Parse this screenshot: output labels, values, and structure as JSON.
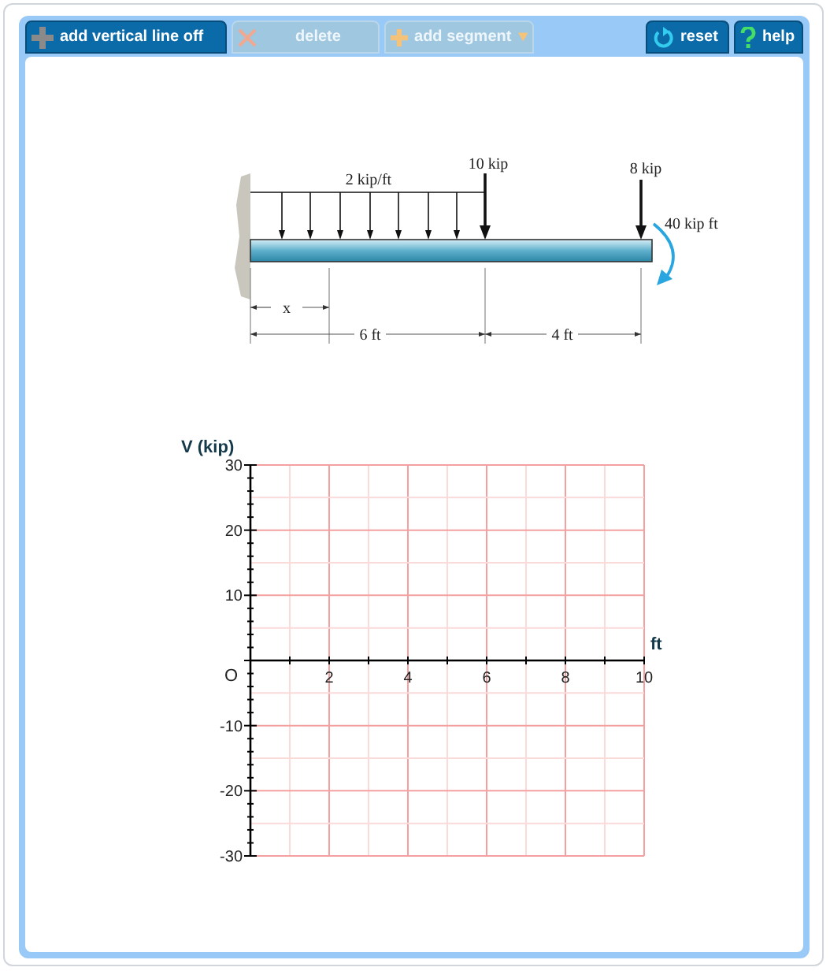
{
  "toolbar": [
    {
      "kind": "toggle",
      "label": "add vertical line off",
      "disabled": false
    },
    {
      "kind": "delete",
      "label": "delete",
      "disabled": true
    },
    {
      "kind": "dropdown",
      "label": "add segment",
      "disabled": true
    },
    {
      "kind": "reset",
      "label": "reset",
      "disabled": false
    },
    {
      "kind": "help",
      "label": "help",
      "disabled": false
    }
  ],
  "beam_diagram": {
    "distributed_load": "2 kip/ft",
    "point_load_1": "10 kip",
    "point_load_2": "8 kip",
    "moment": "40 kip ft",
    "position_label": "x",
    "span_1": "6 ft",
    "span_2": "4 ft"
  },
  "shear_plot": {
    "origin_label": "O",
    "chart_data": {
      "type": "line",
      "xlabel": "ft",
      "ylabel": "V (kip)",
      "xlim": [
        0,
        10
      ],
      "ylim": [
        -30,
        30
      ],
      "xticks": [
        2,
        4,
        6,
        8,
        10
      ],
      "yticks": [
        -30,
        -20,
        -10,
        10,
        20,
        30
      ],
      "grid": true
    }
  }
}
